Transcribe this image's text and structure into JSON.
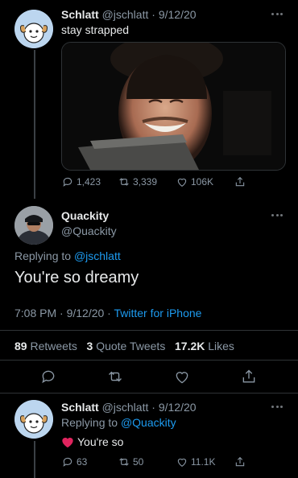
{
  "tweet1": {
    "name": "Schlatt",
    "handle": "@jschlatt",
    "date": "· 9/12/20",
    "text": "stay strapped",
    "replies": "1,423",
    "retweets": "3,339",
    "likes": "106K"
  },
  "main": {
    "name": "Quackity",
    "handle": "@Quackity",
    "replying_label": "Replying to",
    "replying_handle": "@jschlatt",
    "text": "You're so dreamy",
    "time_date": "7:08 PM · 9/12/20 ·",
    "source": "Twitter for iPhone",
    "retweets_count": "89",
    "retweets_label": "Retweets",
    "quotes_count": "3",
    "quotes_label": "Quote Tweets",
    "likes_count": "17.2K",
    "likes_label": "Likes"
  },
  "tweet3": {
    "name": "Schlatt",
    "handle": "@jschlatt",
    "date": "· 9/12/20",
    "replying_label": "Replying to",
    "replying_handle": "@Quackity",
    "text": "You're so",
    "replies": "63",
    "retweets": "50",
    "likes": "11.1K"
  },
  "colors": {
    "accent": "#1d9bf0",
    "muted": "#8b98a5",
    "divider": "#2f3336",
    "heart": "#e0245e"
  }
}
